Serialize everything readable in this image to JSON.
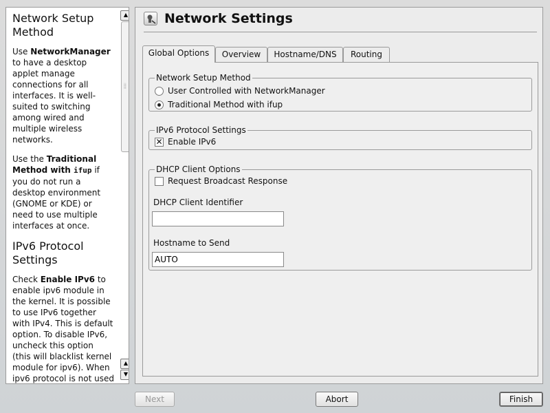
{
  "help": {
    "h1": "Network Setup Method",
    "p1_pre": "Use ",
    "p1_bold": "NetworkManager",
    "p1_post": " to have a desktop applet manage connections for all interfaces. It is well-suited to switching among wired and multiple wireless networks.",
    "p2_pre": "Use the ",
    "p2_bold": "Traditional Method with ",
    "p2_code": "ifup",
    "p2_post": " if you do not run a desktop environment (GNOME or KDE) or need to use multiple interfaces at once.",
    "h2": "IPv6 Protocol Settings",
    "p3_pre": "Check ",
    "p3_bold": "Enable IPv6",
    "p3_post": " to enable ipv6 module in the kernel. It is possible to use IPv6 together with IPv4. This is default option. To disable IPv6, uncheck this option (this will blacklist kernel module for ipv6). When ipv6 protocol is not used"
  },
  "main": {
    "title": "Network Settings",
    "tabs": [
      "Global Options",
      "Overview",
      "Hostname/DNS",
      "Routing"
    ],
    "network_setup": {
      "legend": "Network Setup Method",
      "option_nm": "User Controlled with NetworkManager",
      "option_ifup": "Traditional Method with ifup",
      "selected": "Traditional Method with ifup"
    },
    "ipv6": {
      "legend": "IPv6 Protocol Settings",
      "enable_label": "Enable IPv6",
      "enabled": true
    },
    "dhcp": {
      "legend": "DHCP Client Options",
      "broadcast_label": "Request Broadcast Response",
      "broadcast_checked": false,
      "identifier_label": "DHCP Client Identifier",
      "identifier_value": "",
      "hostname_label": "Hostname to Send",
      "hostname_value": "AUTO"
    }
  },
  "buttons": {
    "next": "Next",
    "abort": "Abort",
    "finish": "Finish"
  }
}
